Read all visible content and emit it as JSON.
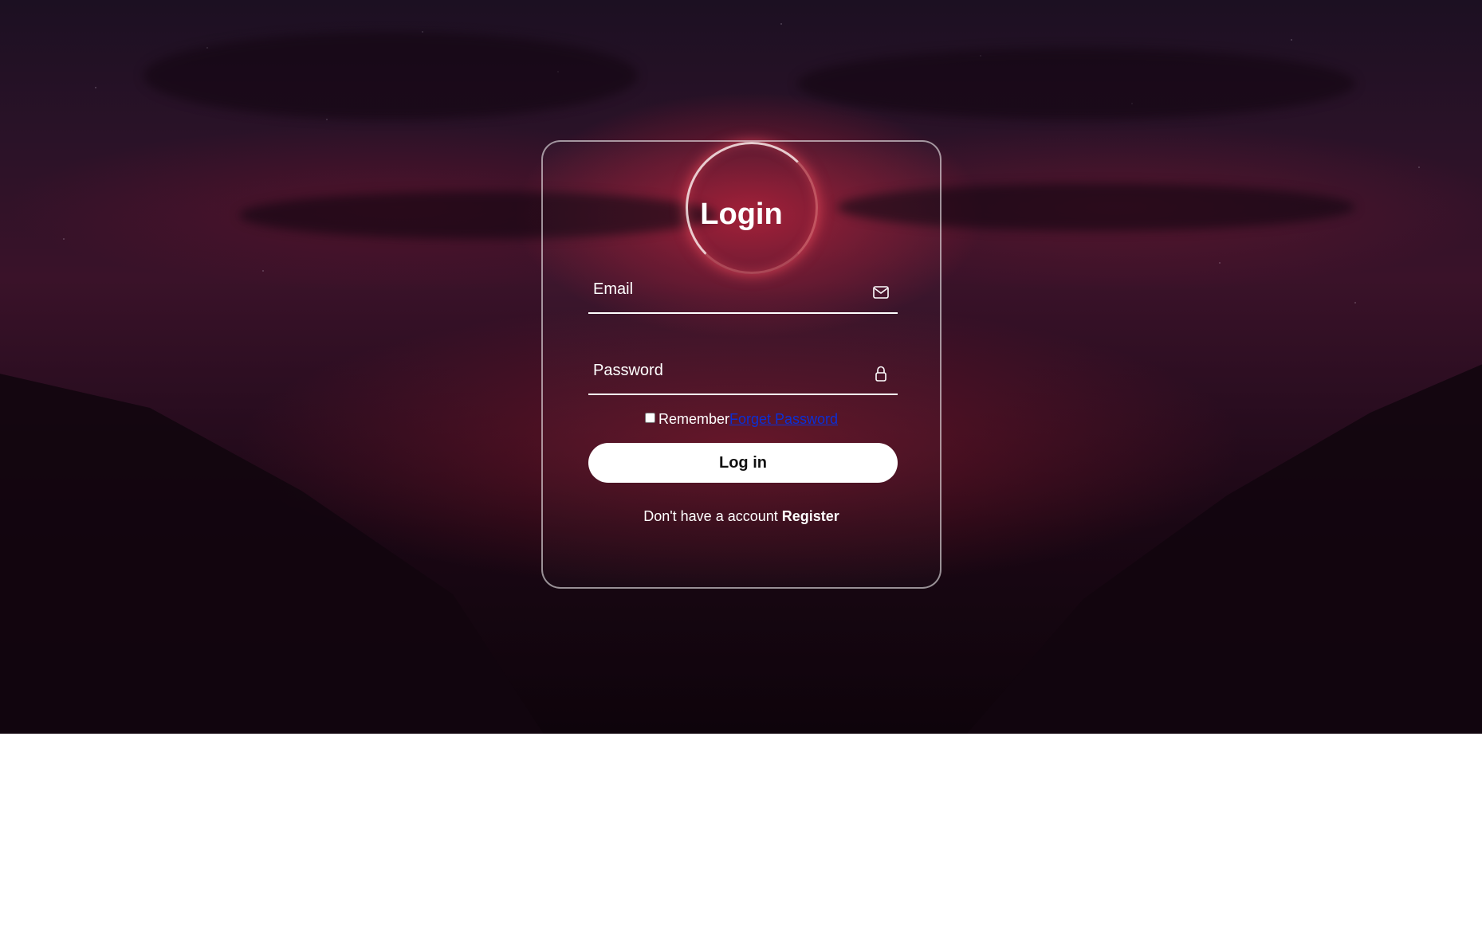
{
  "login": {
    "title": "Login",
    "email_placeholder": "Email",
    "password_placeholder": "Password",
    "remember_label": "Remember",
    "forgot_link": "Forget Password",
    "submit_label": "Log in",
    "register_prompt": "Don't have a account ",
    "register_link": "Register"
  },
  "icons": {
    "email": "mail-icon",
    "password": "lock-icon"
  },
  "colors": {
    "link": "#0b2fd6",
    "button_bg": "#ffffff",
    "text": "#ffffff"
  }
}
